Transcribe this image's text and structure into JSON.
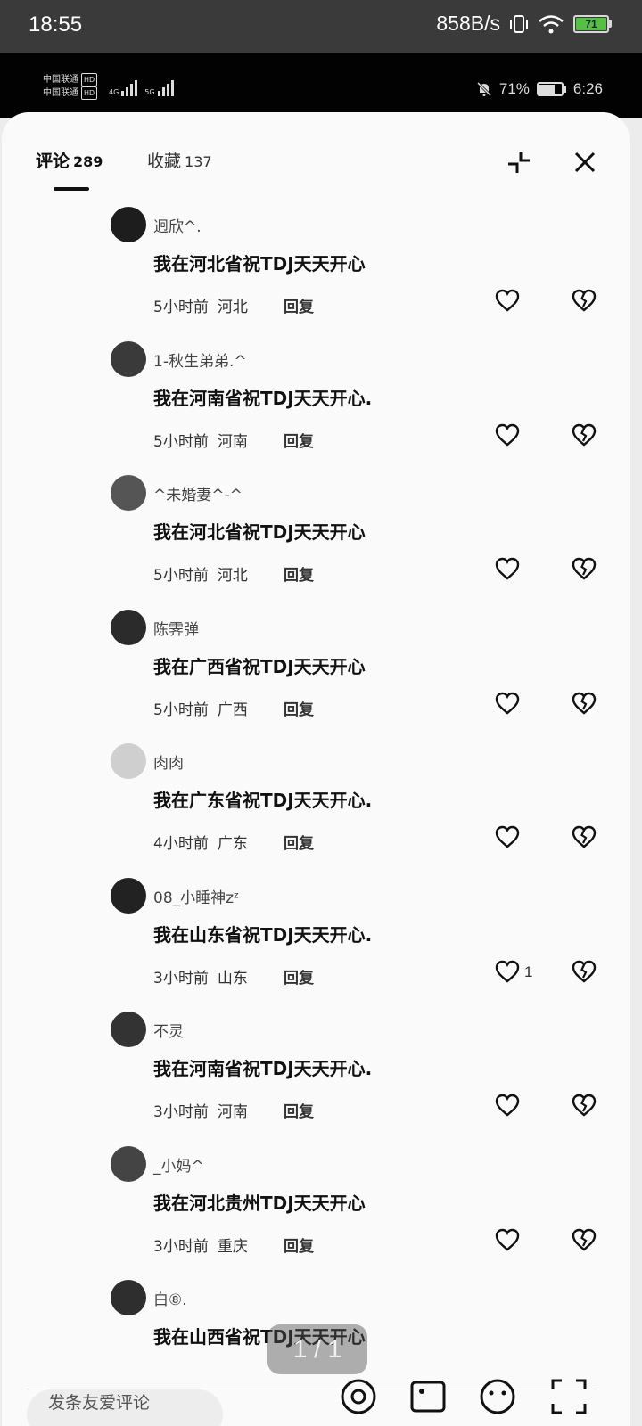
{
  "outer_status": {
    "time": "18:55",
    "net_speed": "858B/s",
    "battery": "71"
  },
  "inner_status": {
    "carrier1": "中国联通",
    "carrier2": "中国联通",
    "hd": "HD",
    "net1": "4G",
    "net2": "5G",
    "battery_pct": "71%",
    "time": "6:26"
  },
  "tabs": {
    "comments_label": "评论",
    "comments_count": "289",
    "fav_label": "收藏",
    "fav_count": "137"
  },
  "comments": [
    {
      "name": "迥欣^.",
      "text": "我在河北省祝TDJ天天开心",
      "time": "5小时前",
      "location": "河北",
      "reply": "回复",
      "likes": ""
    },
    {
      "name": "1-秋生弟弟.^",
      "text": "我在河南省祝TDJ天天开心.",
      "time": "5小时前",
      "location": "河南",
      "reply": "回复",
      "likes": ""
    },
    {
      "name": "^未婚妻^-^",
      "text": "我在河北省祝TDJ天天开心",
      "time": "5小时前",
      "location": "河北",
      "reply": "回复",
      "likes": ""
    },
    {
      "name": "陈霁弹",
      "text": "我在广西省祝TDJ天天开心",
      "time": "5小时前",
      "location": "广西",
      "reply": "回复",
      "likes": ""
    },
    {
      "name": "肉肉",
      "text": "我在广东省祝TDJ天天开心.",
      "time": "4小时前",
      "location": "广东",
      "reply": "回复",
      "likes": ""
    },
    {
      "name": "08_小睡神zᶻ",
      "text": "我在山东省祝TDJ天天开心.",
      "time": "3小时前",
      "location": "山东",
      "reply": "回复",
      "likes": "1"
    },
    {
      "name": "不灵",
      "text": "我在河南省祝TDJ天天开心.",
      "time": "3小时前",
      "location": "河南",
      "reply": "回复",
      "likes": ""
    },
    {
      "name": "_小妈^",
      "text": "我在河北贵州TDJ天天开心",
      "time": "3小时前",
      "location": "重庆",
      "reply": "回复",
      "likes": ""
    },
    {
      "name": "白⑧.",
      "text": "我在山西省祝TDJ天天开心",
      "time": "",
      "location": "",
      "reply": "",
      "likes": ""
    }
  ],
  "page_indicator": "1 / 1",
  "input": {
    "placeholder": "发条友爱评论"
  },
  "icons": [
    "close-icon",
    "collapse-icon",
    "heart-icon",
    "broken-heart-icon",
    "at-icon",
    "image-icon",
    "emoji-icon",
    "scan-icon"
  ]
}
